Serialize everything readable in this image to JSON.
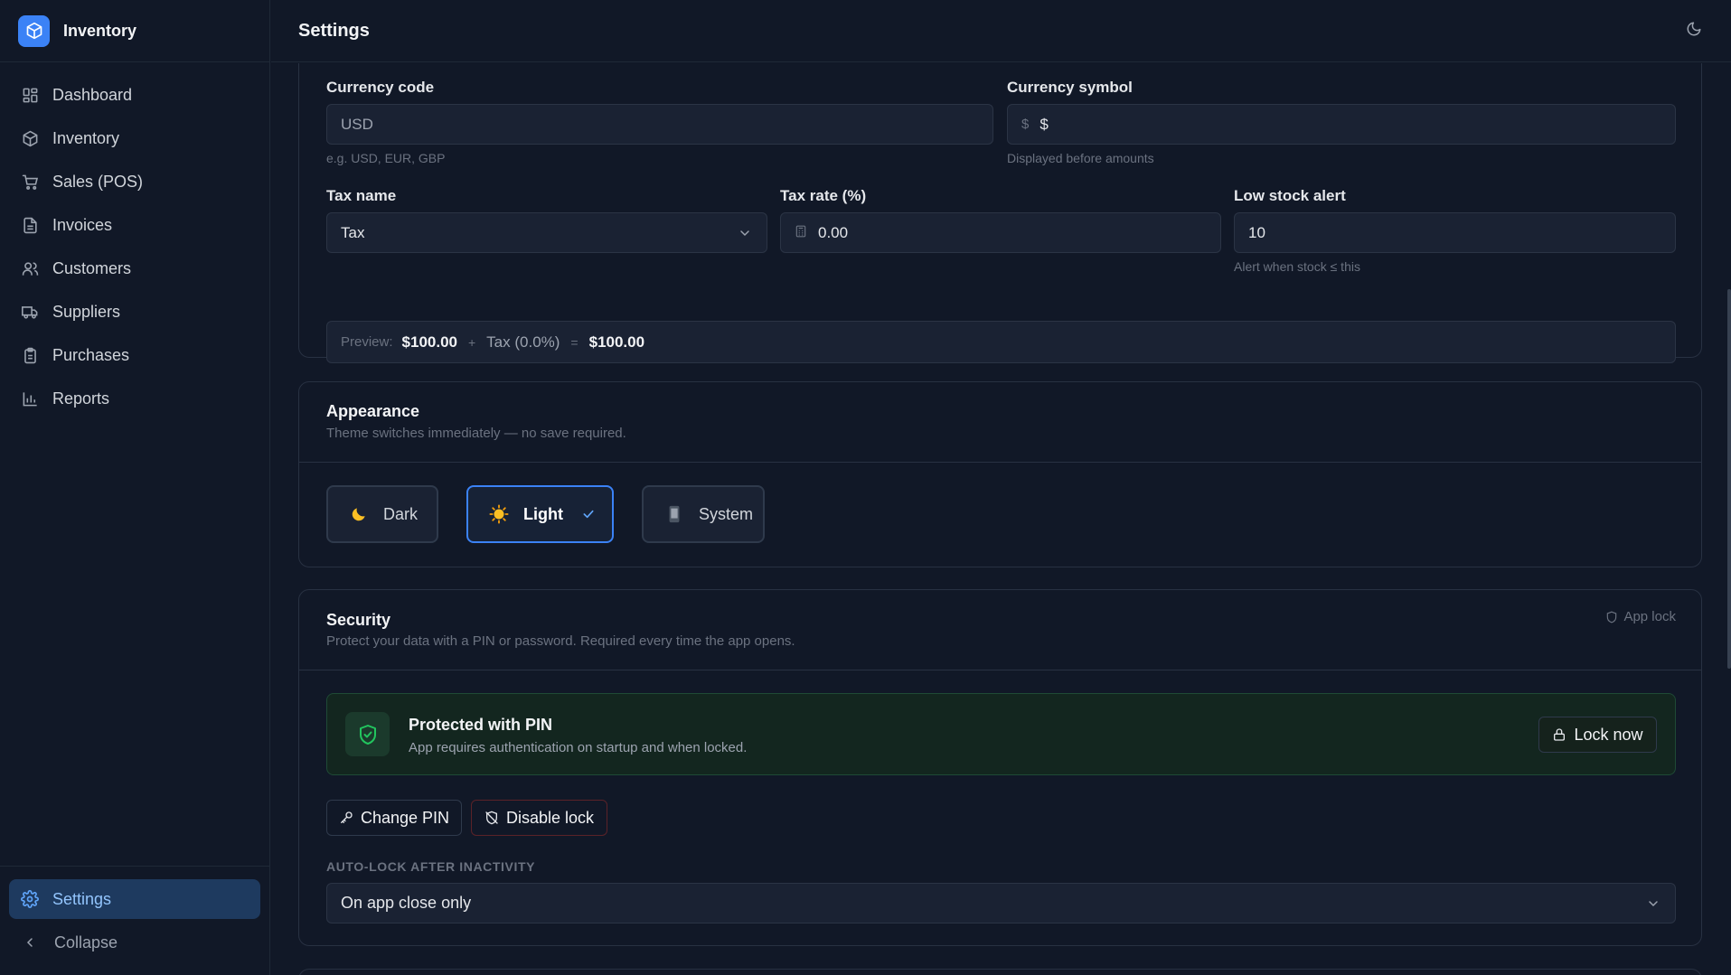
{
  "app": {
    "name": "Inventory"
  },
  "sidebar": {
    "items": [
      {
        "label": "Dashboard",
        "icon": "dashboard-icon"
      },
      {
        "label": "Inventory",
        "icon": "box-icon"
      },
      {
        "label": "Sales (POS)",
        "icon": "cart-icon"
      },
      {
        "label": "Invoices",
        "icon": "invoice-icon"
      },
      {
        "label": "Customers",
        "icon": "users-icon"
      },
      {
        "label": "Suppliers",
        "icon": "truck-icon"
      },
      {
        "label": "Purchases",
        "icon": "clipboard-icon"
      },
      {
        "label": "Reports",
        "icon": "chart-icon"
      }
    ],
    "settings_label": "Settings",
    "collapse_label": "Collapse"
  },
  "header": {
    "title": "Settings",
    "theme_toggle_icon": "moon-icon"
  },
  "general": {
    "currency_code": {
      "label": "Currency code",
      "value": "USD",
      "hint": "e.g. USD, EUR, GBP"
    },
    "currency_symbol": {
      "label": "Currency symbol",
      "prefix": "$",
      "value": "$",
      "hint": "Displayed before amounts"
    },
    "tax_name": {
      "label": "Tax name",
      "value": "Tax"
    },
    "tax_rate": {
      "label": "Tax rate (%)",
      "value": "0.00"
    },
    "low_stock": {
      "label": "Low stock alert",
      "value": "10",
      "hint": "Alert when stock ≤ this"
    },
    "preview": {
      "label": "Preview:",
      "subtotal": "$100.00",
      "plus": "+",
      "tax": "Tax (0.0%)",
      "equals": "=",
      "total": "$100.00"
    }
  },
  "appearance": {
    "title": "Appearance",
    "subtitle": "Theme switches immediately — no save required.",
    "options": [
      {
        "label": "Dark",
        "icon": "moon-emoji-icon"
      },
      {
        "label": "Light",
        "icon": "sun-emoji-icon"
      },
      {
        "label": "System",
        "icon": "phone-icon"
      }
    ],
    "selected": "Light"
  },
  "security": {
    "title": "Security",
    "subtitle": "Protect your data with a PIN or password. Required every time the app opens.",
    "badge": "App lock",
    "status_title": "Protected with PIN",
    "status_sub": "App requires authentication on startup and when locked.",
    "lock_now": "Lock now",
    "change_pin": "Change PIN",
    "disable_lock": "Disable lock",
    "autolock_label": "AUTO-LOCK AFTER INACTIVITY",
    "autolock_value": "On app close only"
  },
  "colors": {
    "accent": "#3b82f6",
    "background": "#111827",
    "success": "#22c55e",
    "danger": "#ef4444"
  }
}
